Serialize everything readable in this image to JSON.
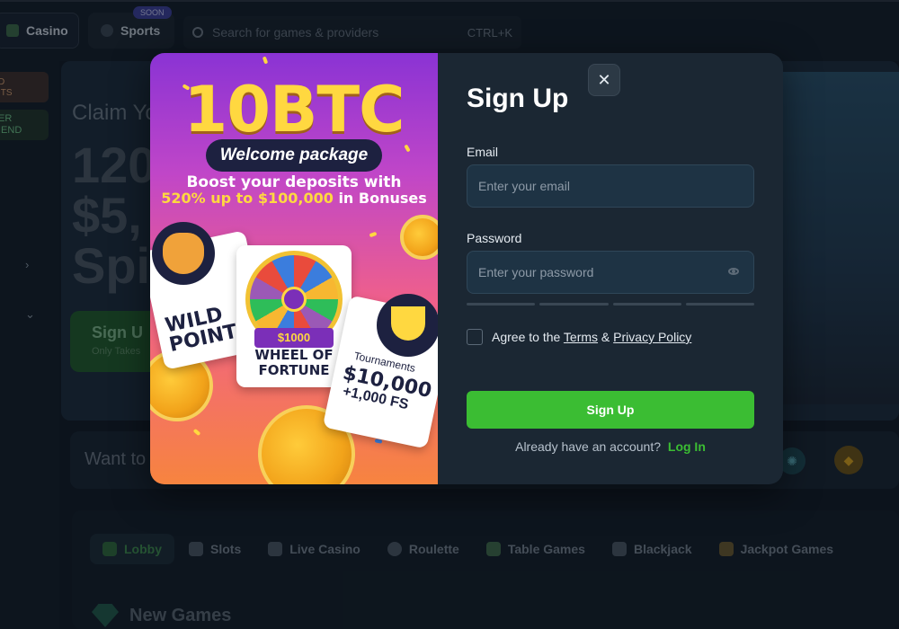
{
  "topbar": {
    "casino_label": "Casino",
    "sports_label": "Sports",
    "soon_badge": "SOON",
    "search_placeholder": "Search for games & providers",
    "search_shortcut": "CTRL+K"
  },
  "sidebar": {
    "chip1_line1": "D",
    "chip1_line2": "ITS",
    "chip2_line1": "ER",
    "chip2_line2": "IEND"
  },
  "hero": {
    "claim_text": "Claim Yo",
    "big_line1": "120",
    "big_line2": "$5,",
    "big_line3": "Spi",
    "cta_label": "Sign U",
    "cta_sub": "Only Takes"
  },
  "want_bar": {
    "text": "Want to"
  },
  "categories": [
    {
      "label": "Lobby",
      "icon": "lobby-icon"
    },
    {
      "label": "Slots",
      "icon": "slots-icon"
    },
    {
      "label": "Live Casino",
      "icon": "live-casino-icon"
    },
    {
      "label": "Roulette",
      "icon": "roulette-icon"
    },
    {
      "label": "Table Games",
      "icon": "table-games-icon"
    },
    {
      "label": "Blackjack",
      "icon": "blackjack-icon"
    },
    {
      "label": "Jackpot Games",
      "icon": "jackpot-icon"
    }
  ],
  "new_games": {
    "title": "New Games"
  },
  "promo": {
    "amount": "10BTC",
    "pill": "Welcome package",
    "line1": "Boost your deposits with",
    "line2_highlight": "520% up to $100,000",
    "line2_rest": " in Bonuses",
    "wild_points_line1": "WILD",
    "wild_points_line2": "POINTS",
    "wheel_line1": "WHEEL OF",
    "wheel_line2": "FORTUNE",
    "wheel_bigwin": "$1000",
    "tournaments_label": "Tournaments",
    "tournaments_amount": "$10,000",
    "tournaments_fs": "+1,000 FS"
  },
  "form": {
    "title": "Sign Up",
    "email_label": "Email",
    "email_placeholder": "Enter your email",
    "password_label": "Password",
    "password_placeholder": "Enter your password",
    "agree_prefix": "Agree to the ",
    "terms_link": "Terms",
    "amp": " & ",
    "privacy_link": "Privacy Policy",
    "submit_label": "Sign Up",
    "have_account": "Already have an account?",
    "login_link": "Log In"
  },
  "colors": {
    "accent_green": "#3bbd33",
    "promo_gold": "#ffd840",
    "bg": "#0f1923"
  }
}
